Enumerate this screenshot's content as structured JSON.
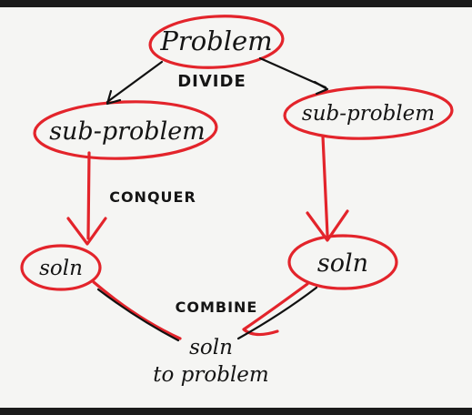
{
  "diagram": {
    "nodes": {
      "problem": "Problem",
      "sub_problem_left": "sub-problem",
      "sub_problem_right": "sub-problem",
      "soln_left": "soln",
      "soln_right": "soln",
      "final_line1": "soln",
      "final_line2": "to problem"
    },
    "labels": {
      "divide": "DIVIDE",
      "conquer": "CONQUER",
      "combine": "COMBINE"
    },
    "colors": {
      "ink": "#111111",
      "highlight": "#e3242b",
      "board": "#f5f5f3",
      "frame": "#1b1b1b"
    }
  }
}
